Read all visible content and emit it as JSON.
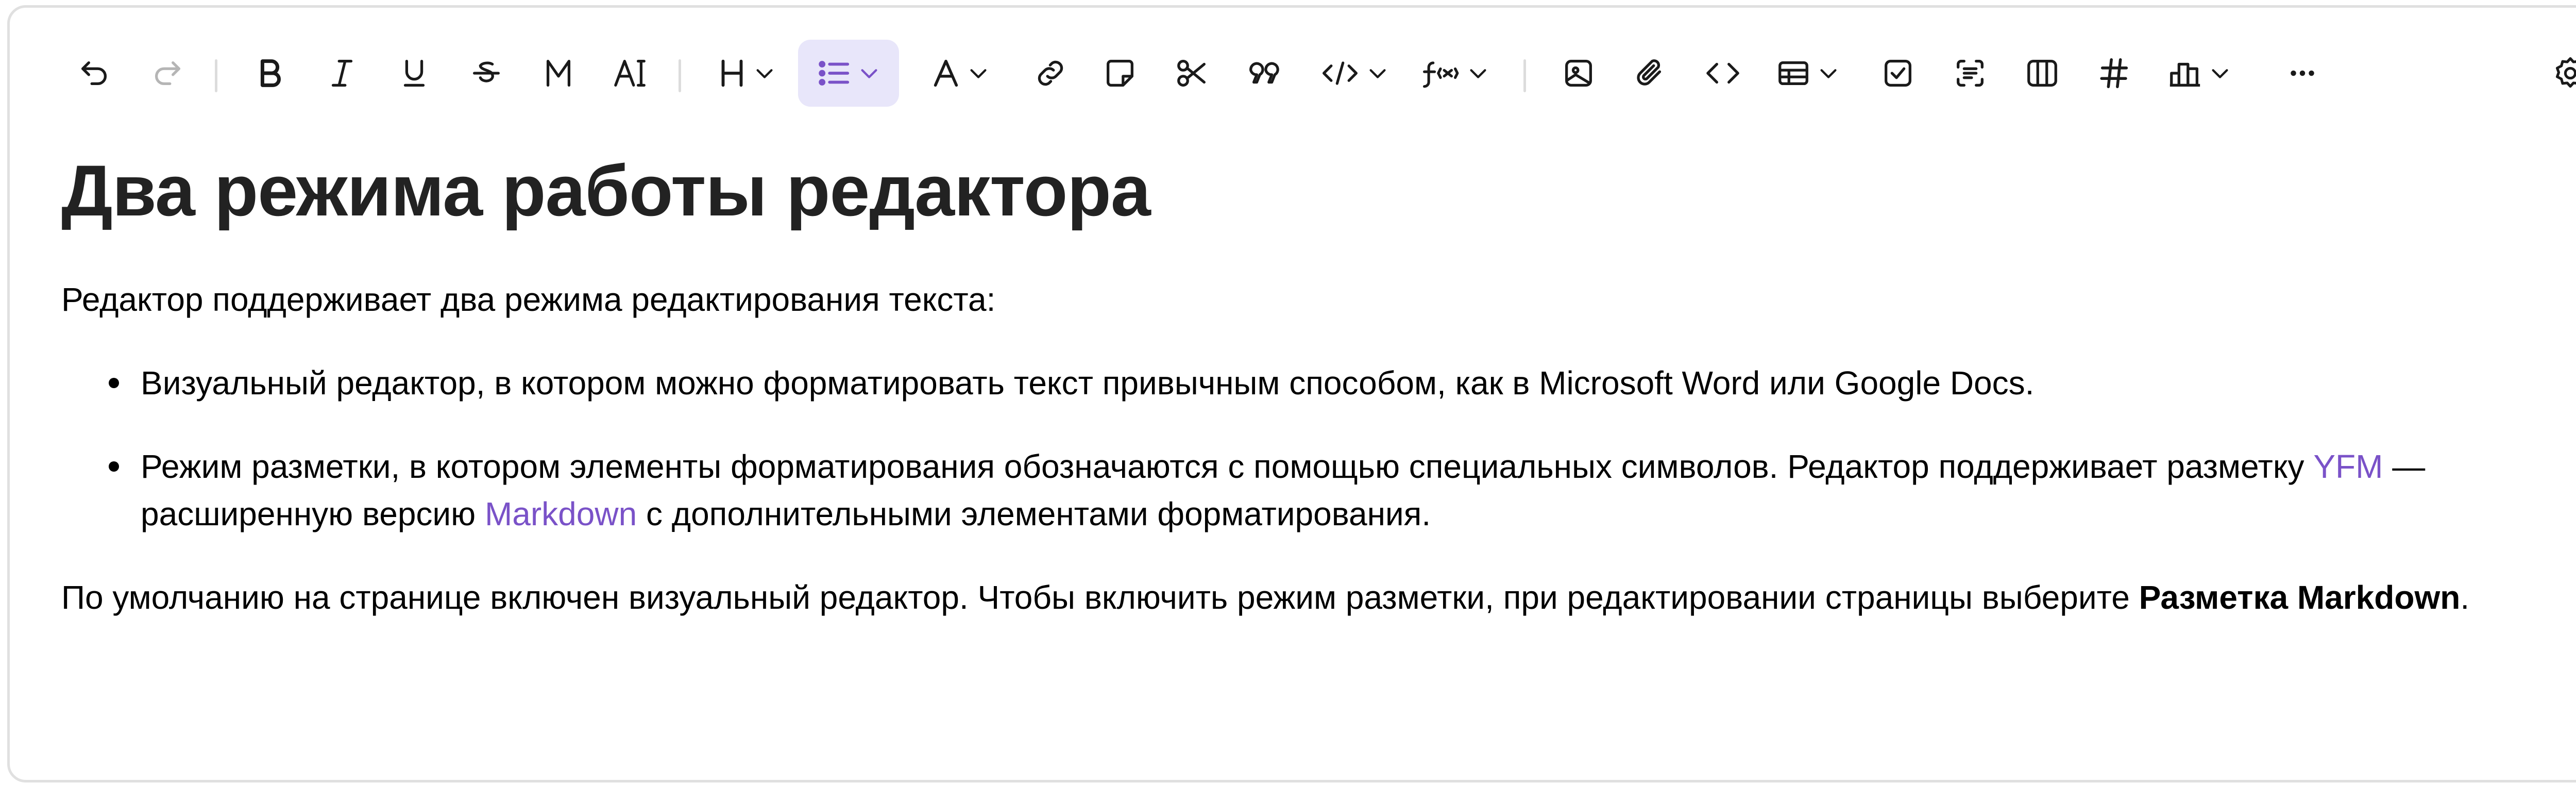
{
  "toolbar": {
    "icons": [
      "undo-icon",
      "redo-icon",
      "bold-icon",
      "italic-icon",
      "underline-icon",
      "strikethrough-icon",
      "monospace-icon",
      "text-marker-icon",
      "heading-icon",
      "list-icon",
      "text-color-icon",
      "link-icon",
      "note-icon",
      "cut-icon",
      "quote-icon",
      "code-inline-icon",
      "formula-icon",
      "image-icon",
      "attachment-icon",
      "code-block-icon",
      "table-icon",
      "checkbox-icon",
      "yfm-block-icon",
      "columns-icon",
      "hashtag-icon",
      "chart-icon",
      "more-icon",
      "settings-icon"
    ],
    "labels": {
      "heading": "H",
      "text_color": "A",
      "formula": "f(x)"
    }
  },
  "document": {
    "title": "Два режима работы редактора",
    "intro": "Редактор поддерживает два режима редактирования текста:",
    "list": [
      {
        "text": "Визуальный редактор, в котором можно форматировать текст привычным способом, как в Microsoft Word или Google Docs."
      },
      {
        "text_before": "Режим разметки, в котором элементы форматирования обозначаются с помощью специальных символов. Редактор поддерживает разметку ",
        "link1": "YFM",
        "text_middle": " — расширенную версию ",
        "link2": "Markdown",
        "text_after": " с дополнительными элементами форматирования."
      }
    ],
    "final_before": "По умолчанию на странице включен визуальный редактор. Чтобы включить режим разметки, при редактировании страницы выберите ",
    "final_bold": "Разметка Markdown",
    "final_after": "."
  },
  "colors": {
    "accent": "#7a52c8",
    "active_bg": "#e8e6fa",
    "icon": "#1a1a1a",
    "border": "#e0e0e0"
  }
}
